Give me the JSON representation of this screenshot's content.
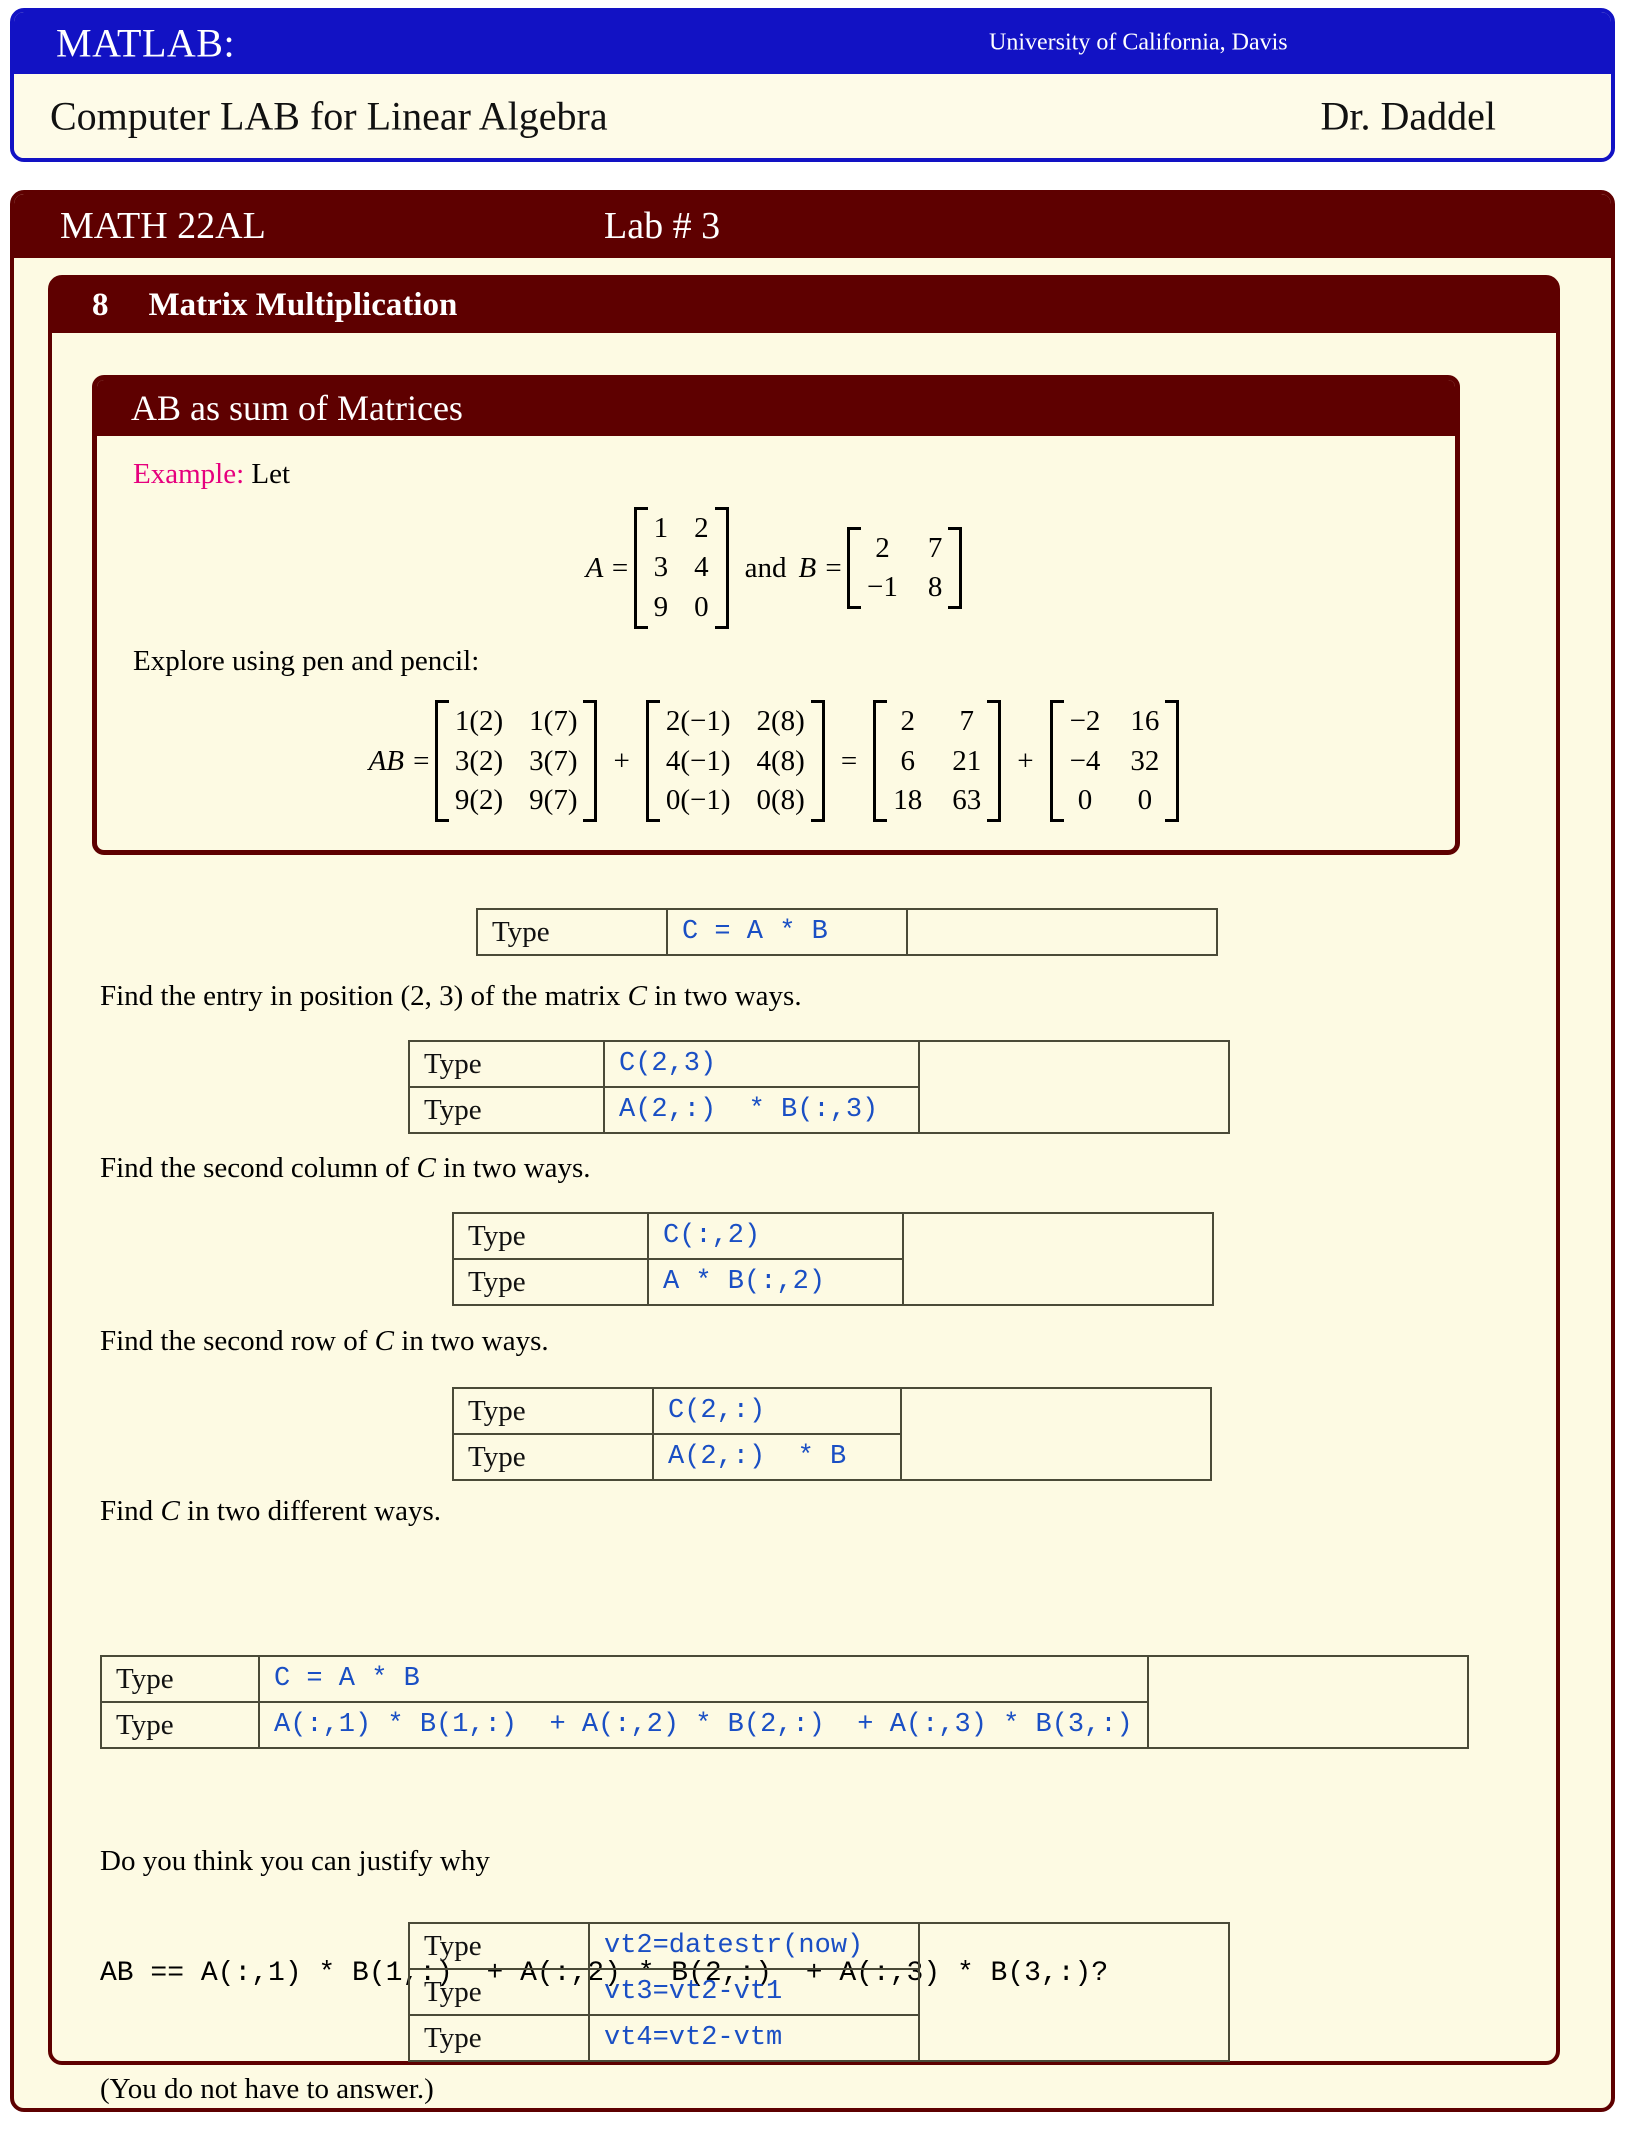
{
  "header": {
    "brand": "MATLAB:",
    "institution": "University of California, Davis",
    "course_title": "Computer LAB for Linear Algebra",
    "instructor": "Dr. Daddel",
    "accent_blue": "#1212C4",
    "accent_maroon": "#5E0000",
    "paper_cream": "#FDFAE3"
  },
  "page": {
    "course_code": "MATH 22AL",
    "lab_label": "Lab # 3"
  },
  "section": {
    "number": "8",
    "title": "Matrix Multiplication"
  },
  "ab_box": {
    "heading": "AB as sum of Matrices",
    "example_keyword": "Example:",
    "example_text": "Let",
    "explore_text": "Explore using pen and pencil:",
    "matrix_A_label": "A =",
    "and_text": "and",
    "matrix_B_label": "B =",
    "matrix_A": [
      [
        "1",
        "2"
      ],
      [
        "3",
        "4"
      ],
      [
        "9",
        "0"
      ]
    ],
    "matrix_B": [
      [
        "2",
        "7"
      ],
      [
        "−1",
        "8"
      ]
    ],
    "ab_label": "AB =",
    "term1": [
      [
        "1(2)",
        "1(7)"
      ],
      [
        "3(2)",
        "3(7)"
      ],
      [
        "9(2)",
        "9(7)"
      ]
    ],
    "plus1": "+",
    "term2": [
      [
        "2(−1)",
        "2(8)"
      ],
      [
        "4(−1)",
        "4(8)"
      ],
      [
        "0(−1)",
        "0(8)"
      ]
    ],
    "equals": "=",
    "term3": [
      [
        "2",
        "7"
      ],
      [
        "6",
        "21"
      ],
      [
        "18",
        "63"
      ]
    ],
    "plus2": "+",
    "term4": [
      [
        "−2",
        "16"
      ],
      [
        "−4",
        "32"
      ],
      [
        "0",
        "0"
      ]
    ]
  },
  "prompts": {
    "find_entry": "Find the entry in position (2, 3) of the matrix C in two ways.",
    "find_entry_pre": "Find the entry in position (2, 3) of the matrix ",
    "find_entry_var": "C",
    "find_entry_post": " in two ways.",
    "find_col_pre": "Find the second column of ",
    "find_col_var": "C",
    "find_col_post": " in two ways.",
    "find_row_pre": "Find the second row of ",
    "find_row_var": "C",
    "find_row_post": " in two ways.",
    "find_c_pre": "Find ",
    "find_c_var": "C",
    "find_c_post": " in two different ways."
  },
  "type_label": "Type",
  "tables": {
    "t1": {
      "rows": [
        {
          "label": "Type",
          "command": "C = A * B"
        }
      ]
    },
    "t2": {
      "rows": [
        {
          "label": "Type",
          "command": "C(2,3)"
        },
        {
          "label": "Type",
          "command": "A(2,:)  * B(:,3)"
        }
      ]
    },
    "t3": {
      "rows": [
        {
          "label": "Type",
          "command": "C(:,2)"
        },
        {
          "label": "Type",
          "command": "A * B(:,2)"
        }
      ]
    },
    "t4": {
      "rows": [
        {
          "label": "Type",
          "command": "C(2,:)"
        },
        {
          "label": "Type",
          "command": "A(2,:)  * B"
        }
      ]
    },
    "t5": {
      "rows": [
        {
          "label": "Type",
          "command": "C = A * B"
        },
        {
          "label": "Type",
          "command": "A(:,1) * B(1,:)  + A(:,2) * B(2,:)  + A(:,3) * B(3,:)"
        }
      ]
    },
    "t6": {
      "rows": [
        {
          "label": "Type",
          "command": "vt2=datestr(now)"
        },
        {
          "label": "Type",
          "command": "vt3=vt2-vt1"
        },
        {
          "label": "Type",
          "command": "vt4=vt2-vtm"
        }
      ]
    }
  },
  "justify": {
    "line1": "Do you think you can justify why",
    "line2": "AB == A(:,1) * B(1,:)  + A(:,2) * B(2,:)  + A(:,3) * B(3,:)?",
    "line3": "(You do not have to answer.)"
  }
}
